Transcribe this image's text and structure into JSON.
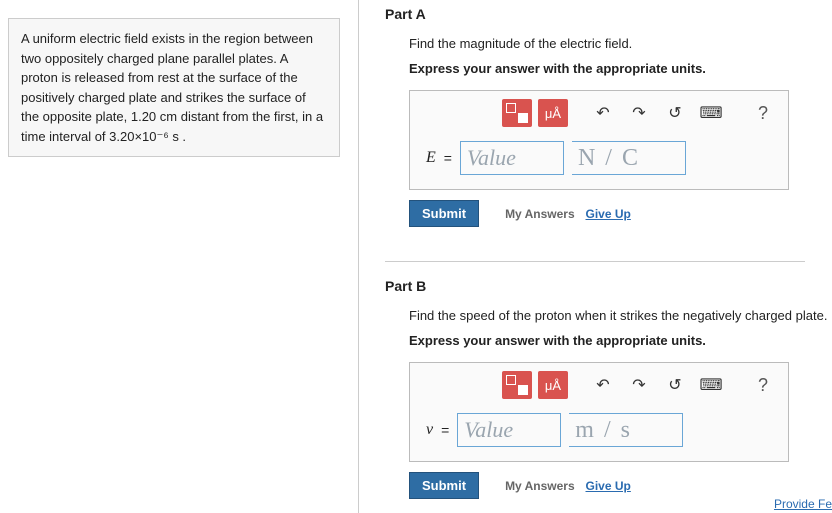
{
  "problem": {
    "text": "A uniform electric field exists in the region between two oppositely charged plane parallel plates. A proton is released from rest at the surface of the positively charged plate and strikes the surface of the opposite plate, 1.20  cm distant from the first, in a time interval of 3.20×10⁻⁶  s ."
  },
  "parts": [
    {
      "title": "Part A",
      "prompt": "Find the magnitude of the electric field.",
      "instruction": "Express your answer with the appropriate units.",
      "toolbar": {
        "units_label": "μÅ",
        "help": "?"
      },
      "variable": "E",
      "value_placeholder": "Value",
      "units_placeholder": "N / C",
      "submit": "Submit",
      "my_answers": "My Answers",
      "give_up": "Give Up"
    },
    {
      "title": "Part B",
      "prompt": "Find the speed of the proton when it strikes the negatively charged plate.",
      "instruction": "Express your answer with the appropriate units.",
      "toolbar": {
        "units_label": "μÅ",
        "help": "?"
      },
      "variable": "v",
      "value_placeholder": "Value",
      "units_placeholder": "m / s",
      "submit": "Submit",
      "my_answers": "My Answers",
      "give_up": "Give Up"
    }
  ],
  "footer": {
    "feedback": "Provide Fe"
  }
}
